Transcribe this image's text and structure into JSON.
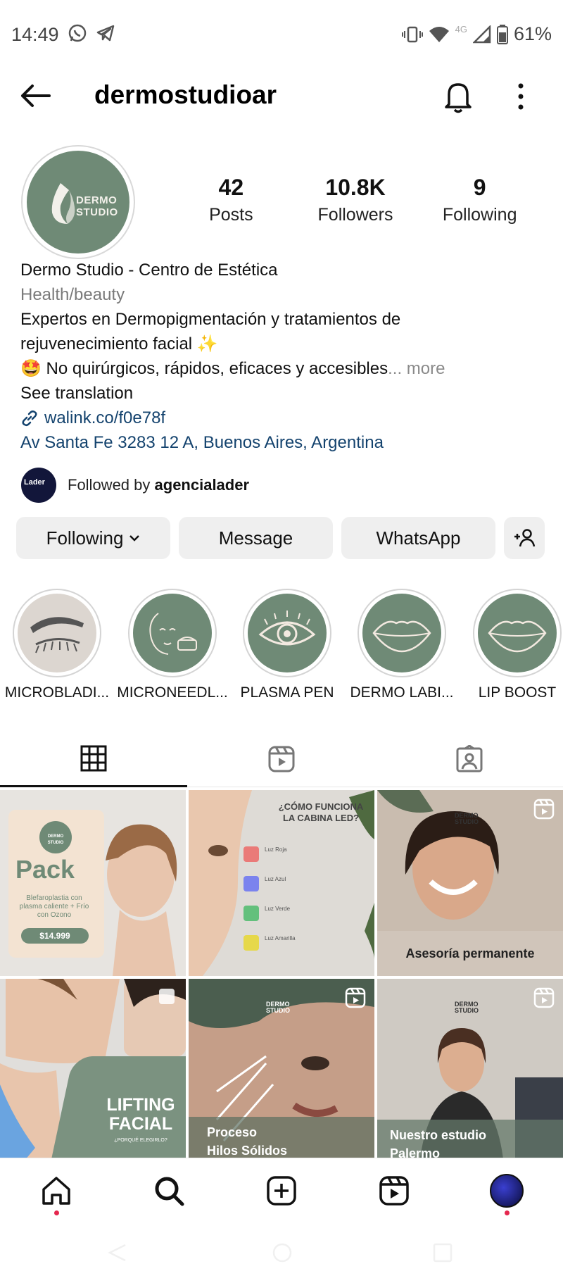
{
  "status_bar": {
    "time": "14:49",
    "network": "4G",
    "battery": "61%"
  },
  "header": {
    "username": "dermostudioar"
  },
  "profile": {
    "avatar_text": [
      "DERMO",
      "STUDIO"
    ],
    "stats": [
      {
        "value": "42",
        "label": "Posts"
      },
      {
        "value": "10.8K",
        "label": "Followers"
      },
      {
        "value": "9",
        "label": "Following"
      }
    ],
    "name": "Dermo Studio - Centro de Estética",
    "category": "Health/beauty",
    "bio_line_1": "Expertos en Dermopigmentación y tratamientos de",
    "bio_line_2": "rejuvenecimiento facial ✨",
    "bio_line_3": "🤩 No quirúrgicos, rápidos, eficaces y accesibles",
    "bio_ellipsis": "...",
    "more": "more",
    "see_translation": "See translation",
    "link": "walink.co/f0e78f",
    "address": "Av Santa Fe 3283 12 A, Buenos Aires, Argentina",
    "followed_by_prefix": "Followed by",
    "followed_by_user": "agencialader",
    "followed_by_avatar": "Lader"
  },
  "actions": {
    "following": "Following",
    "message": "Message",
    "whatsapp": "WhatsApp"
  },
  "highlights": [
    {
      "label": "MICROBLADI...",
      "icon": "eyebrow-icon"
    },
    {
      "label": "MICRONEEDL...",
      "icon": "face-cream-icon"
    },
    {
      "label": "PLASMA PEN",
      "icon": "eye-icon"
    },
    {
      "label": "DERMO LABI...",
      "icon": "lips-icon"
    },
    {
      "label": "LIP BOOST",
      "icon": "lips-icon"
    }
  ],
  "posts": {
    "pack": {
      "logo": [
        "DERMO",
        "STUDIO"
      ],
      "title": "Pack",
      "desc": "Blefaroplastia con plasma caliente + Frío con Ozono",
      "price": "$14.999"
    },
    "led": {
      "title": "¿CÓMO FUNCIONA LA CABINA LED?",
      "items": [
        "Luz Roja",
        "Luz Azul",
        "Luz Verde",
        "Luz Amarilla"
      ]
    },
    "asesoria": {
      "caption": "Asesoría permanente",
      "logo": [
        "DERMO",
        "STUDIO"
      ]
    },
    "lifting": {
      "title_1": "LIFTING",
      "title_2": "FACIAL",
      "sub": "¿PORQUÉ ELEGIRLO?"
    },
    "hilos": {
      "caption_1": "Proceso",
      "caption_2": "Hilos Sólidos",
      "logo": [
        "DERMO",
        "STUDIO"
      ]
    },
    "estudio": {
      "caption_1": "Nuestro estudio",
      "caption_2": "Palermo",
      "logo": [
        "DERMO",
        "STUDIO"
      ]
    }
  },
  "colors": {
    "brand_green": "#6f8a76",
    "link_blue": "#14436e",
    "notification_red": "#e5274e"
  }
}
